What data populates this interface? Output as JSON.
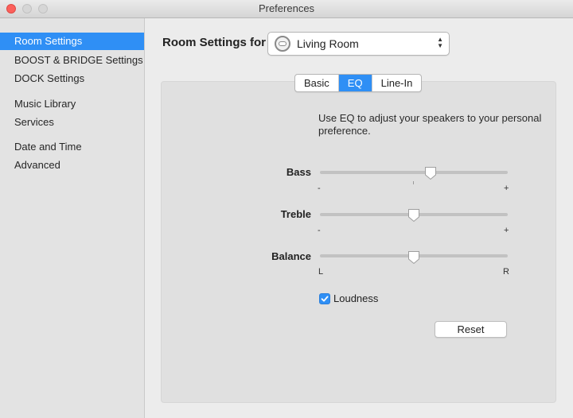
{
  "window": {
    "title": "Preferences"
  },
  "sidebar": {
    "items": [
      {
        "label": "Room Settings",
        "selected": true
      },
      {
        "label": "BOOST & BRIDGE Settings"
      },
      {
        "label": "DOCK Settings"
      },
      {
        "label": "Music Library"
      },
      {
        "label": "Services"
      },
      {
        "label": "Date and Time"
      },
      {
        "label": "Advanced"
      }
    ]
  },
  "header": {
    "label": "Room Settings for",
    "room_select": {
      "value": "Living Room",
      "icon": "speaker-icon"
    }
  },
  "tabs": [
    {
      "label": "Basic",
      "active": false
    },
    {
      "label": "EQ",
      "active": true
    },
    {
      "label": "Line-In",
      "active": false
    }
  ],
  "eq": {
    "description": "Use EQ to adjust your speakers to your personal preference.",
    "sliders": [
      {
        "label": "Bass",
        "min_label": "-",
        "max_label": "+",
        "value_fraction": 0.59
      },
      {
        "label": "Treble",
        "min_label": "-",
        "max_label": "+",
        "value_fraction": 0.5
      },
      {
        "label": "Balance",
        "min_label": "L",
        "max_label": "R",
        "value_fraction": 0.5
      }
    ],
    "loudness": {
      "label": "Loudness",
      "checked": true
    },
    "reset_label": "Reset"
  },
  "colors": {
    "accent": "#2f8ff5",
    "close": "#fc605b"
  }
}
